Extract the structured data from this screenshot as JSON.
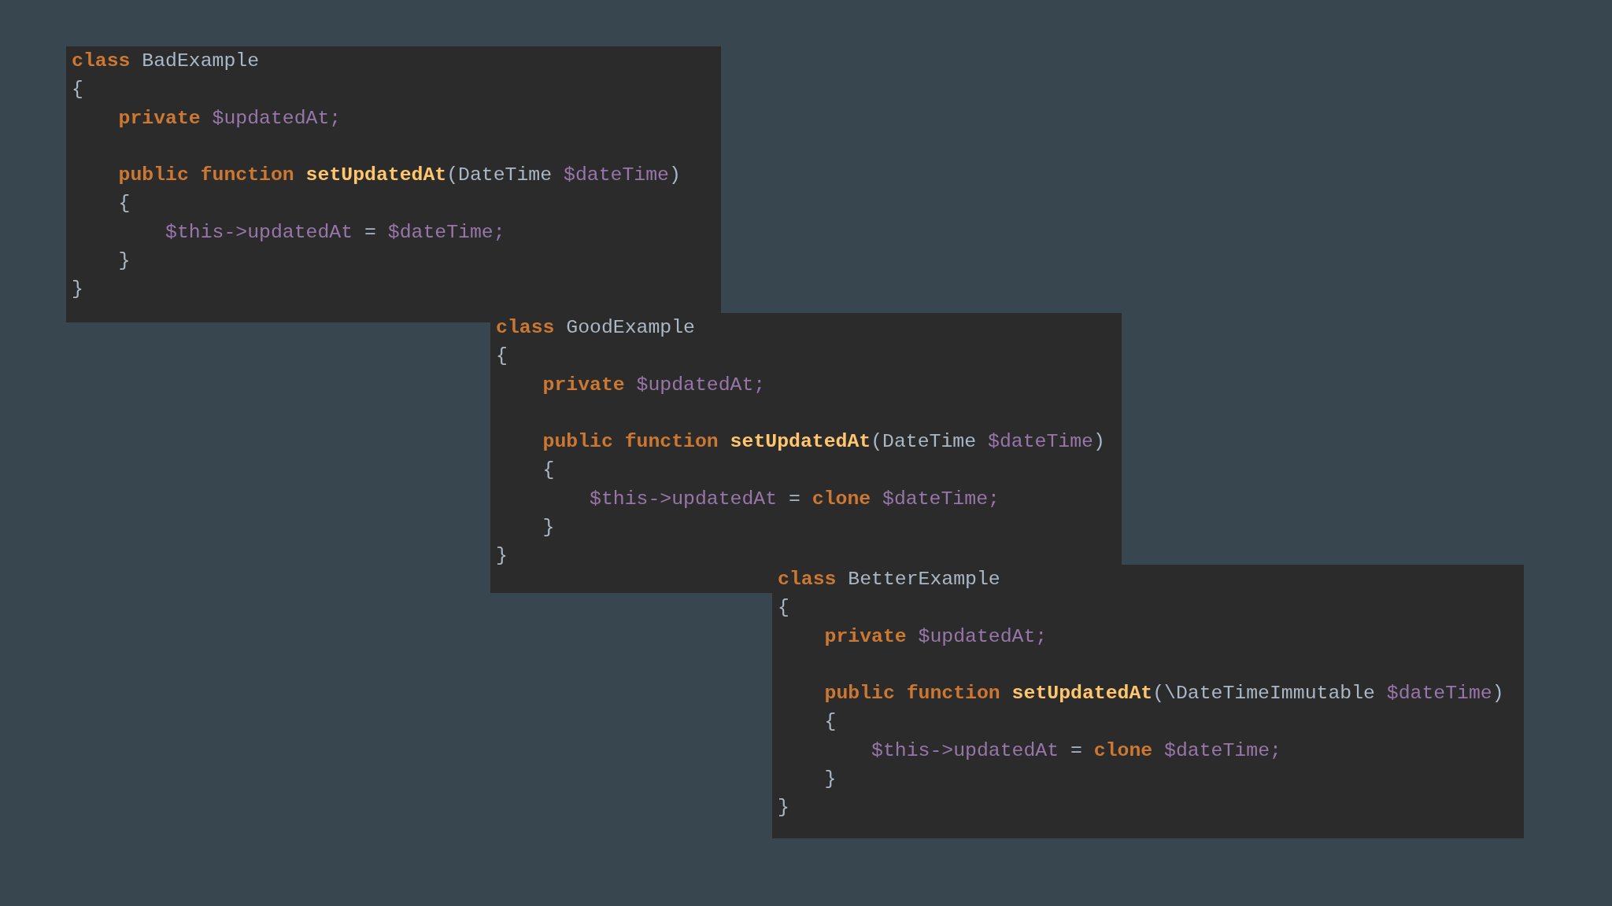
{
  "panels": [
    {
      "lines": [
        {
          "kind": "code",
          "tokens": [
            {
              "kind": "keyword",
              "text": "class"
            },
            {
              "kind": "plain",
              "text": " BadExample"
            }
          ]
        },
        {
          "kind": "code",
          "tokens": [
            {
              "kind": "plain",
              "text": "{"
            }
          ]
        },
        {
          "kind": "code",
          "tokens": [
            {
              "kind": "keyword",
              "text": "    private"
            },
            {
              "kind": "variable",
              "text": " $updatedAt;"
            }
          ]
        },
        {
          "kind": "blank"
        },
        {
          "kind": "code",
          "tokens": [
            {
              "kind": "keyword",
              "text": "    public function"
            },
            {
              "kind": "function",
              "text": " setUpdatedAt"
            },
            {
              "kind": "plain",
              "text": "(DateTime "
            },
            {
              "kind": "variable",
              "text": "$dateTime"
            },
            {
              "kind": "plain",
              "text": ")"
            }
          ]
        },
        {
          "kind": "code",
          "tokens": [
            {
              "kind": "plain",
              "text": "    {"
            }
          ]
        },
        {
          "kind": "code",
          "tokens": [
            {
              "kind": "variable",
              "text": "        $this->updatedAt"
            },
            {
              "kind": "plain",
              "text": " = "
            },
            {
              "kind": "variable",
              "text": "$dateTime;"
            }
          ]
        },
        {
          "kind": "code",
          "tokens": [
            {
              "kind": "plain",
              "text": "    }"
            }
          ]
        },
        {
          "kind": "code",
          "tokens": [
            {
              "kind": "plain",
              "text": "}"
            }
          ]
        }
      ]
    },
    {
      "lines": [
        {
          "kind": "code",
          "tokens": [
            {
              "kind": "keyword",
              "text": "class"
            },
            {
              "kind": "plain",
              "text": " GoodExample"
            }
          ]
        },
        {
          "kind": "code",
          "tokens": [
            {
              "kind": "plain",
              "text": "{"
            }
          ]
        },
        {
          "kind": "code",
          "tokens": [
            {
              "kind": "keyword",
              "text": "    private"
            },
            {
              "kind": "variable",
              "text": " $updatedAt;"
            }
          ]
        },
        {
          "kind": "blank"
        },
        {
          "kind": "code",
          "tokens": [
            {
              "kind": "keyword",
              "text": "    public function"
            },
            {
              "kind": "function",
              "text": " setUpdatedAt"
            },
            {
              "kind": "plain",
              "text": "(DateTime "
            },
            {
              "kind": "variable",
              "text": "$dateTime"
            },
            {
              "kind": "plain",
              "text": ")"
            }
          ]
        },
        {
          "kind": "code",
          "tokens": [
            {
              "kind": "plain",
              "text": "    {"
            }
          ]
        },
        {
          "kind": "code",
          "tokens": [
            {
              "kind": "variable",
              "text": "        $this->updatedAt"
            },
            {
              "kind": "plain",
              "text": " = "
            },
            {
              "kind": "keyword",
              "text": "clone"
            },
            {
              "kind": "variable",
              "text": " $dateTime;"
            }
          ]
        },
        {
          "kind": "code",
          "tokens": [
            {
              "kind": "plain",
              "text": "    }"
            }
          ]
        },
        {
          "kind": "code",
          "tokens": [
            {
              "kind": "plain",
              "text": "}"
            }
          ]
        }
      ]
    },
    {
      "lines": [
        {
          "kind": "code",
          "tokens": [
            {
              "kind": "keyword",
              "text": "class"
            },
            {
              "kind": "plain",
              "text": " BetterExample"
            }
          ]
        },
        {
          "kind": "code",
          "tokens": [
            {
              "kind": "plain",
              "text": "{"
            }
          ]
        },
        {
          "kind": "code",
          "tokens": [
            {
              "kind": "keyword",
              "text": "    private"
            },
            {
              "kind": "variable",
              "text": " $updatedAt;"
            }
          ]
        },
        {
          "kind": "blank"
        },
        {
          "kind": "code",
          "tokens": [
            {
              "kind": "keyword",
              "text": "    public function"
            },
            {
              "kind": "function",
              "text": " setUpdatedAt"
            },
            {
              "kind": "plain",
              "text": "(\\DateTimeImmutable "
            },
            {
              "kind": "variable",
              "text": "$dateTime"
            },
            {
              "kind": "plain",
              "text": ")"
            }
          ]
        },
        {
          "kind": "code",
          "tokens": [
            {
              "kind": "plain",
              "text": "    {"
            }
          ]
        },
        {
          "kind": "code",
          "tokens": [
            {
              "kind": "variable",
              "text": "        $this->updatedAt"
            },
            {
              "kind": "plain",
              "text": " = "
            },
            {
              "kind": "keyword",
              "text": "clone"
            },
            {
              "kind": "variable",
              "text": " $dateTime;"
            }
          ]
        },
        {
          "kind": "code",
          "tokens": [
            {
              "kind": "plain",
              "text": "    }"
            }
          ]
        },
        {
          "kind": "code",
          "tokens": [
            {
              "kind": "plain",
              "text": "}"
            }
          ]
        }
      ]
    }
  ]
}
